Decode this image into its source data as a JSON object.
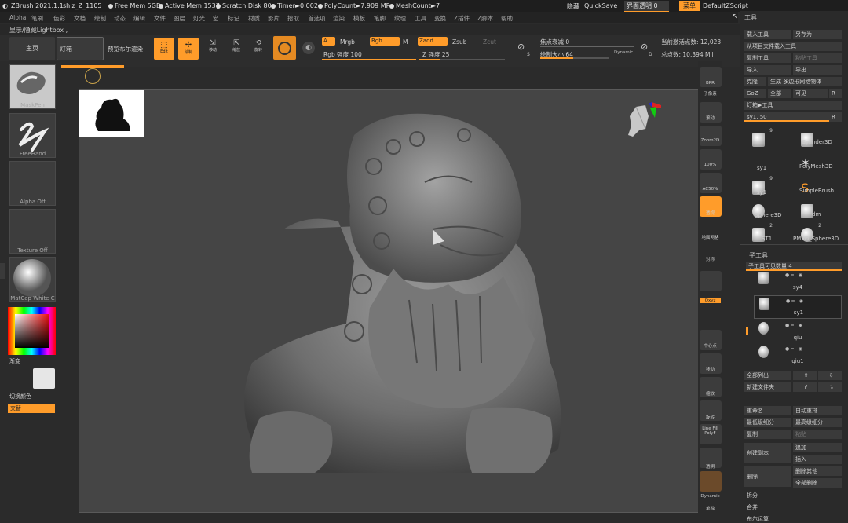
{
  "titlebar": {
    "app": "ZBrush 2021.1.1",
    "file": "shiz_Z_1105",
    "free_mem": "Free Mem 5GB",
    "active_mem": "Active Mem 1537",
    "scratch": "Scratch Disk 80",
    "timer": "Timer►0.002",
    "polycount": "PolyCount►7.909 MP",
    "meshcount": "MeshCount►7",
    "hide": "隐藏",
    "quicksave": "QuickSave",
    "ui_transparency": "界面透明 0",
    "menus": "菜单",
    "script": "DefaultZScript"
  },
  "menubar": [
    "Alpha",
    "笔刷",
    "色彩",
    "文档",
    "绘制",
    "动态",
    "编辑",
    "文件",
    "图层",
    "灯光",
    "宏",
    "标记",
    "材质",
    "影片",
    "拾取",
    "首选项",
    "渲染",
    "模板",
    "笔脚",
    "纹理",
    "工具",
    "变换",
    "Z插件",
    "Z脚本",
    "帮助"
  ],
  "lightbox": {
    "toggle": "显示/隐藏Lightbox ,"
  },
  "toolbar": {
    "home": "主页",
    "lightbox": "灯箱",
    "preview_render": "预览布尔渲染",
    "edit": "Edit",
    "draw": "绘制",
    "move": "移动",
    "scale": "缩放",
    "rotate": "旋转",
    "a_label": "A",
    "mrgb": "Mrgb",
    "rgb": "Rgb",
    "m": "M",
    "rgb_strength": "Rgb 强度 100",
    "zadd": "Zadd",
    "zsub": "Zsub",
    "zcut": "Zcut",
    "z_strength": "Z 强度 25",
    "focal_shift": "焦点衰减 0",
    "draw_size": "绘制大小 64",
    "dynamic": "Dynamic",
    "active_points": "当前激活点数: 12,023",
    "total_points": "总点数: 10.394 Mil",
    "s": "S",
    "d": "D"
  },
  "leftbar": {
    "brush": "MaskPen",
    "stroke": "FreeHand",
    "alpha": "Alpha Off",
    "texture": "Texture Off",
    "material": "MatCap White C",
    "gradient": "渐变",
    "switch_color": "切换颜色",
    "alternate": "交替"
  },
  "rightstrip": [
    "BPR",
    "子像素",
    "滚动",
    "Zoom2D",
    "100%",
    "AC50%",
    "透视",
    "地面网格",
    "对称",
    "",
    "Lsym",
    "Qxyz",
    "",
    "",
    "中心点",
    "移动",
    "缩放",
    "旋转",
    "Line Fill PolyF",
    "透明",
    "",
    "Dynamic",
    "单独"
  ],
  "panel": {
    "title": "工具",
    "load_tool": "载入工具",
    "save_as": "另存为",
    "load_from_project": "从项目文件载入工具",
    "copy_tool": "复制工具",
    "paste_tool": "粘贴工具",
    "import": "导入",
    "export": "导出",
    "clone": "克隆",
    "make_polymesh": "生成 多边形网格物体",
    "goz": "GoZ",
    "all": "全部",
    "visible": "可见",
    "r": "R",
    "lightbox_tools": "灯箱▶工具",
    "sy1_label": "sy1. 50",
    "tools": [
      {
        "name": "sy1",
        "badge": "9"
      },
      {
        "name": "Cylinder3D",
        "badge": ""
      },
      {
        "name": "PolyMesh3D",
        "badge": ""
      },
      {
        "name": "sy1",
        "badge": "9"
      },
      {
        "name": "SimpleBrush",
        "badge": ""
      },
      {
        "name": "Sphere3D",
        "badge": ""
      },
      {
        "name": "dm",
        "badge": ""
      },
      {
        "name": "ST1",
        "badge": "2"
      },
      {
        "name": "PM3D_Sphere3D",
        "badge": "2"
      }
    ],
    "subtool": {
      "title": "子工具",
      "visible_count": "子工具可见数量 4",
      "items": [
        "sy4",
        "sy1",
        "qiu",
        "qiu1"
      ]
    },
    "list_all": "全部列出",
    "new_folder": "新建文件夹",
    "rename": "重命名",
    "auto_reorder": "自动重排",
    "lowest_subdiv": "最低级细分",
    "highest_subdiv": "最高级细分",
    "duplicate": "复制",
    "paste": "粘贴",
    "create_copy": "创建副本",
    "append": "追加",
    "insert": "插入",
    "delete": "删除",
    "delete_other": "删除其他",
    "delete_all": "全部删除",
    "split": "拆分",
    "merge": "合并",
    "boolean": "布尔运算"
  }
}
